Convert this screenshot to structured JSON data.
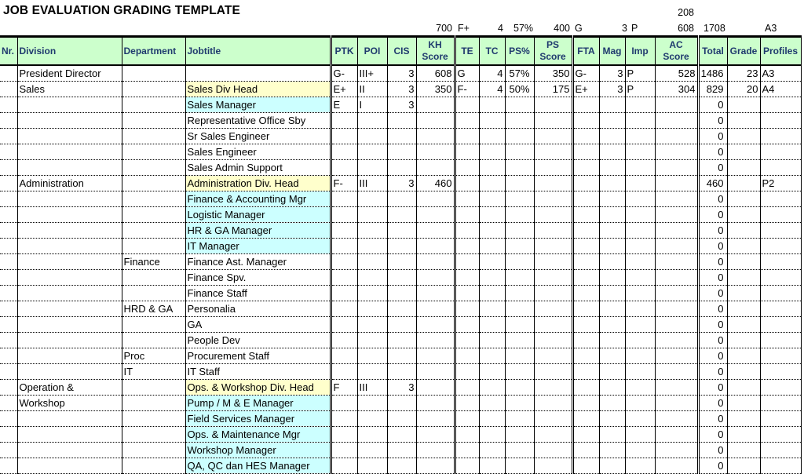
{
  "title": "JOB EVALUATION GRADING TEMPLATE",
  "summary_top": {
    "ac_top": "208",
    "kh_score": "700",
    "te": "F+",
    "tc": "4",
    "ps_pct": "57%",
    "ps_score": "400",
    "fta": "G",
    "mag": "3",
    "imp": "P",
    "ac_score": "608",
    "total": "1708",
    "profiles": "A3"
  },
  "headers": {
    "nr": "Nr.",
    "division": "Division",
    "department": "Department",
    "jobtitle": "Jobtitle",
    "ptk": "PTK",
    "poi": "POI",
    "cis": "CIS",
    "kh_score_1": "KH",
    "kh_score_2": "Score",
    "te": "TE",
    "tc": "TC",
    "ps_pct": "PS%",
    "ps_score_1": "PS",
    "ps_score_2": "Score",
    "fta": "FTA",
    "mag": "Mag",
    "imp": "Imp",
    "ac_score_1": "AC",
    "ac_score_2": "Score",
    "total": "Total",
    "grade": "Grade",
    "profiles": "Profiles"
  },
  "colors": {
    "header_bg": "#ccffcc",
    "header_text": "#1f3a6e",
    "div_head_bg": "#ffffcc",
    "manager_bg": "#ccffff"
  },
  "rows": [
    {
      "nr": "",
      "division": "President Director",
      "department": "",
      "jobtitle": "",
      "hl": "",
      "ptk": "G-",
      "poi": "III+",
      "cis": "3",
      "kh": "608",
      "te": "G",
      "tc": "4",
      "ps_pct": "57%",
      "ps": "350",
      "fta": "G-",
      "mag": "3",
      "imp": "P",
      "ac": "528",
      "total": "1486",
      "grade": "23",
      "profiles": "A3"
    },
    {
      "nr": "",
      "division": "Sales",
      "department": "",
      "jobtitle": "Sales Div Head",
      "hl": "yellow",
      "ptk": "E+",
      "poi": "II",
      "cis": "3",
      "kh": "350",
      "te": "F-",
      "tc": "4",
      "ps_pct": "50%",
      "ps": "175",
      "fta": "E+",
      "mag": "3",
      "imp": "P",
      "ac": "304",
      "total": "829",
      "grade": "20",
      "profiles": "A4"
    },
    {
      "nr": "",
      "division": "",
      "department": "",
      "jobtitle": "Sales Manager",
      "hl": "cyan",
      "ptk": "E",
      "poi": "I",
      "cis": "3",
      "kh": "",
      "te": "",
      "tc": "",
      "ps_pct": "",
      "ps": "",
      "fta": "",
      "mag": "",
      "imp": "",
      "ac": "",
      "total": "0",
      "grade": "",
      "profiles": ""
    },
    {
      "nr": "",
      "division": "",
      "department": "",
      "jobtitle": "Representative Office Sby",
      "hl": "",
      "ptk": "",
      "poi": "",
      "cis": "",
      "kh": "",
      "te": "",
      "tc": "",
      "ps_pct": "",
      "ps": "",
      "fta": "",
      "mag": "",
      "imp": "",
      "ac": "",
      "total": "0",
      "grade": "",
      "profiles": ""
    },
    {
      "nr": "",
      "division": "",
      "department": "",
      "jobtitle": "Sr Sales Engineer",
      "hl": "",
      "ptk": "",
      "poi": "",
      "cis": "",
      "kh": "",
      "te": "",
      "tc": "",
      "ps_pct": "",
      "ps": "",
      "fta": "",
      "mag": "",
      "imp": "",
      "ac": "",
      "total": "0",
      "grade": "",
      "profiles": ""
    },
    {
      "nr": "",
      "division": "",
      "department": "",
      "jobtitle": "Sales Engineer",
      "hl": "",
      "ptk": "",
      "poi": "",
      "cis": "",
      "kh": "",
      "te": "",
      "tc": "",
      "ps_pct": "",
      "ps": "",
      "fta": "",
      "mag": "",
      "imp": "",
      "ac": "",
      "total": "0",
      "grade": "",
      "profiles": ""
    },
    {
      "nr": "",
      "division": "",
      "department": "",
      "jobtitle": "Sales Admin Support",
      "hl": "",
      "ptk": "",
      "poi": "",
      "cis": "",
      "kh": "",
      "te": "",
      "tc": "",
      "ps_pct": "",
      "ps": "",
      "fta": "",
      "mag": "",
      "imp": "",
      "ac": "",
      "total": "0",
      "grade": "",
      "profiles": ""
    },
    {
      "nr": "",
      "division": "Administration",
      "department": "",
      "jobtitle": "Administration Div. Head",
      "hl": "yellow",
      "ptk": "F-",
      "poi": "III",
      "cis": "3",
      "kh": "460",
      "te": "",
      "tc": "",
      "ps_pct": "",
      "ps": "",
      "fta": "",
      "mag": "",
      "imp": "",
      "ac": "",
      "total": "460",
      "grade": "",
      "profiles": "P2"
    },
    {
      "nr": "",
      "division": "",
      "department": "",
      "jobtitle": "Finance & Accounting Mgr",
      "hl": "cyan",
      "ptk": "",
      "poi": "",
      "cis": "",
      "kh": "",
      "te": "",
      "tc": "",
      "ps_pct": "",
      "ps": "",
      "fta": "",
      "mag": "",
      "imp": "",
      "ac": "",
      "total": "0",
      "grade": "",
      "profiles": ""
    },
    {
      "nr": "",
      "division": "",
      "department": "",
      "jobtitle": "Logistic Manager",
      "hl": "cyan",
      "ptk": "",
      "poi": "",
      "cis": "",
      "kh": "",
      "te": "",
      "tc": "",
      "ps_pct": "",
      "ps": "",
      "fta": "",
      "mag": "",
      "imp": "",
      "ac": "",
      "total": "0",
      "grade": "",
      "profiles": ""
    },
    {
      "nr": "",
      "division": "",
      "department": "",
      "jobtitle": "HR & GA Manager",
      "hl": "cyan",
      "ptk": "",
      "poi": "",
      "cis": "",
      "kh": "",
      "te": "",
      "tc": "",
      "ps_pct": "",
      "ps": "",
      "fta": "",
      "mag": "",
      "imp": "",
      "ac": "",
      "total": "0",
      "grade": "",
      "profiles": ""
    },
    {
      "nr": "",
      "division": "",
      "department": "",
      "jobtitle": "IT Manager",
      "hl": "cyan",
      "ptk": "",
      "poi": "",
      "cis": "",
      "kh": "",
      "te": "",
      "tc": "",
      "ps_pct": "",
      "ps": "",
      "fta": "",
      "mag": "",
      "imp": "",
      "ac": "",
      "total": "0",
      "grade": "",
      "profiles": ""
    },
    {
      "nr": "",
      "division": "",
      "department": "Finance",
      "jobtitle": "Finance Ast. Manager",
      "hl": "",
      "ptk": "",
      "poi": "",
      "cis": "",
      "kh": "",
      "te": "",
      "tc": "",
      "ps_pct": "",
      "ps": "",
      "fta": "",
      "mag": "",
      "imp": "",
      "ac": "",
      "total": "0",
      "grade": "",
      "profiles": ""
    },
    {
      "nr": "",
      "division": "",
      "department": "",
      "jobtitle": "Finance Spv.",
      "hl": "",
      "ptk": "",
      "poi": "",
      "cis": "",
      "kh": "",
      "te": "",
      "tc": "",
      "ps_pct": "",
      "ps": "",
      "fta": "",
      "mag": "",
      "imp": "",
      "ac": "",
      "total": "0",
      "grade": "",
      "profiles": ""
    },
    {
      "nr": "",
      "division": "",
      "department": "",
      "jobtitle": "Finance Staff",
      "hl": "",
      "ptk": "",
      "poi": "",
      "cis": "",
      "kh": "",
      "te": "",
      "tc": "",
      "ps_pct": "",
      "ps": "",
      "fta": "",
      "mag": "",
      "imp": "",
      "ac": "",
      "total": "0",
      "grade": "",
      "profiles": ""
    },
    {
      "nr": "",
      "division": "",
      "department": "HRD & GA",
      "jobtitle": "Personalia",
      "hl": "",
      "ptk": "",
      "poi": "",
      "cis": "",
      "kh": "",
      "te": "",
      "tc": "",
      "ps_pct": "",
      "ps": "",
      "fta": "",
      "mag": "",
      "imp": "",
      "ac": "",
      "total": "0",
      "grade": "",
      "profiles": ""
    },
    {
      "nr": "",
      "division": "",
      "department": "",
      "jobtitle": "GA",
      "hl": "",
      "ptk": "",
      "poi": "",
      "cis": "",
      "kh": "",
      "te": "",
      "tc": "",
      "ps_pct": "",
      "ps": "",
      "fta": "",
      "mag": "",
      "imp": "",
      "ac": "",
      "total": "0",
      "grade": "",
      "profiles": ""
    },
    {
      "nr": "",
      "division": "",
      "department": "",
      "jobtitle": "People Dev",
      "hl": "",
      "ptk": "",
      "poi": "",
      "cis": "",
      "kh": "",
      "te": "",
      "tc": "",
      "ps_pct": "",
      "ps": "",
      "fta": "",
      "mag": "",
      "imp": "",
      "ac": "",
      "total": "0",
      "grade": "",
      "profiles": ""
    },
    {
      "nr": "",
      "division": "",
      "department": "Proc",
      "jobtitle": "Procurement Staff",
      "hl": "",
      "ptk": "",
      "poi": "",
      "cis": "",
      "kh": "",
      "te": "",
      "tc": "",
      "ps_pct": "",
      "ps": "",
      "fta": "",
      "mag": "",
      "imp": "",
      "ac": "",
      "total": "0",
      "grade": "",
      "profiles": ""
    },
    {
      "nr": "",
      "division": "",
      "department": "IT",
      "jobtitle": "IT Staff",
      "hl": "",
      "ptk": "",
      "poi": "",
      "cis": "",
      "kh": "",
      "te": "",
      "tc": "",
      "ps_pct": "",
      "ps": "",
      "fta": "",
      "mag": "",
      "imp": "",
      "ac": "",
      "total": "0",
      "grade": "",
      "profiles": ""
    },
    {
      "nr": "",
      "division": "Operation &",
      "department": "",
      "jobtitle": "Ops. & Workshop Div. Head",
      "hl": "yellow",
      "ptk": "F",
      "poi": "III",
      "cis": "3",
      "kh": "",
      "te": "",
      "tc": "",
      "ps_pct": "",
      "ps": "",
      "fta": "",
      "mag": "",
      "imp": "",
      "ac": "",
      "total": "0",
      "grade": "",
      "profiles": ""
    },
    {
      "nr": "",
      "division": "Workshop",
      "department": "",
      "jobtitle": "Pump / M & E Manager",
      "hl": "cyan",
      "ptk": "",
      "poi": "",
      "cis": "",
      "kh": "",
      "te": "",
      "tc": "",
      "ps_pct": "",
      "ps": "",
      "fta": "",
      "mag": "",
      "imp": "",
      "ac": "",
      "total": "0",
      "grade": "",
      "profiles": ""
    },
    {
      "nr": "",
      "division": "",
      "department": "",
      "jobtitle": " Field Services Manager",
      "hl": "cyan",
      "ptk": "",
      "poi": "",
      "cis": "",
      "kh": "",
      "te": "",
      "tc": "",
      "ps_pct": "",
      "ps": "",
      "fta": "",
      "mag": "",
      "imp": "",
      "ac": "",
      "total": "0",
      "grade": "",
      "profiles": ""
    },
    {
      "nr": "",
      "division": "",
      "department": "",
      "jobtitle": "Ops. & Maintenance Mgr",
      "hl": "cyan",
      "ptk": "",
      "poi": "",
      "cis": "",
      "kh": "",
      "te": "",
      "tc": "",
      "ps_pct": "",
      "ps": "",
      "fta": "",
      "mag": "",
      "imp": "",
      "ac": "",
      "total": "0",
      "grade": "",
      "profiles": ""
    },
    {
      "nr": "",
      "division": "",
      "department": "",
      "jobtitle": "Workshop Manager",
      "hl": "cyan",
      "ptk": "",
      "poi": "",
      "cis": "",
      "kh": "",
      "te": "",
      "tc": "",
      "ps_pct": "",
      "ps": "",
      "fta": "",
      "mag": "",
      "imp": "",
      "ac": "",
      "total": "0",
      "grade": "",
      "profiles": ""
    },
    {
      "nr": "",
      "division": "",
      "department": "",
      "jobtitle": "QA, QC dan HES Manager",
      "hl": "cyan",
      "ptk": "",
      "poi": "",
      "cis": "",
      "kh": "",
      "te": "",
      "tc": "",
      "ps_pct": "",
      "ps": "",
      "fta": "",
      "mag": "",
      "imp": "",
      "ac": "",
      "total": "0",
      "grade": "",
      "profiles": ""
    }
  ]
}
